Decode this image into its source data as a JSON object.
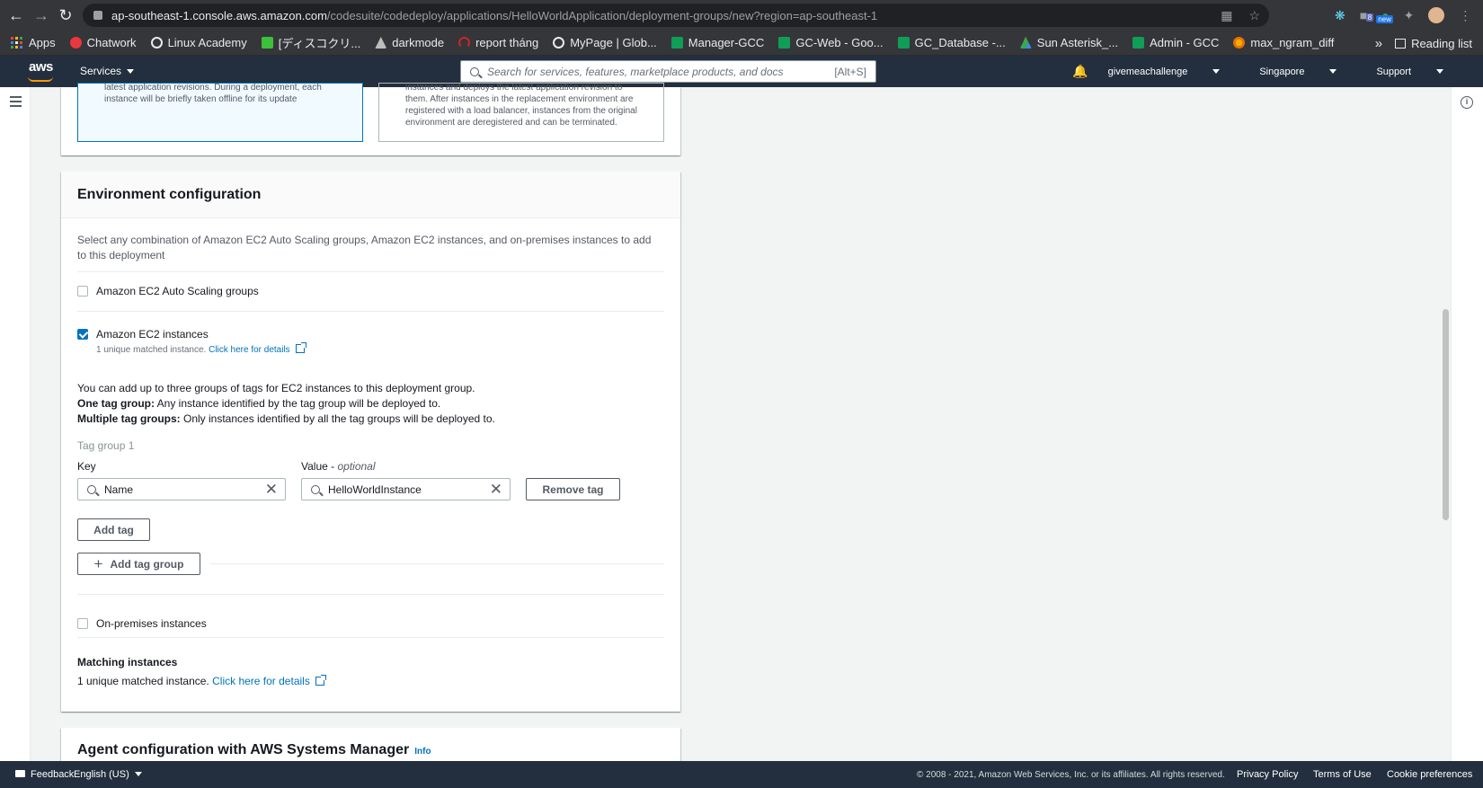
{
  "browser": {
    "url_host": "ap-southeast-1.console.aws.amazon.com",
    "url_path": "/codesuite/codedeploy/applications/HelloWorldApplication/deployment-groups/new?region=ap-southeast-1",
    "ext_badge_1": "8",
    "ext_badge_2": "new",
    "bookmarks": [
      "Apps",
      "Chatwork",
      "Linux Academy",
      "[ディスコクリ...",
      "darkmode",
      "report tháng",
      "MyPage | Glob...",
      "Manager-GCC",
      "GC-Web - Goo...",
      "GC_Database -...",
      "Sun Asterisk_...",
      "Admin - GCC",
      "max_ngram_diff"
    ],
    "more_bookmarks": "»",
    "reading_list": "Reading list"
  },
  "aws_header": {
    "logo": "aws",
    "services": "Services",
    "search_placeholder": "Search for services, features, marketplace products, and docs",
    "search_shortcut": "[Alt+S]",
    "account": "givemeachallenge",
    "region": "Singapore",
    "support": "Support"
  },
  "deployment_tiles": {
    "in_place": [
      "latest application revisions. During a deployment, each",
      "instance will be briefly taken offline for its update"
    ],
    "blue_green": [
      "instances and deploys the latest application revision to",
      "them. After instances in the replacement environment are",
      "registered with a load balancer, instances from the original",
      "environment are deregistered and can be terminated."
    ]
  },
  "env_config": {
    "title": "Environment configuration",
    "description": "Select any combination of Amazon EC2 Auto Scaling groups, Amazon EC2 instances, and on-premises instances to add to this deployment",
    "asg_label": "Amazon EC2 Auto Scaling groups",
    "ec2_label": "Amazon EC2 instances",
    "ec2_matched": "1 unique matched instance.",
    "details_link": "Click here for details",
    "tags_info_line1": "You can add up to three groups of tags for EC2 instances to this deployment group.",
    "one_tag_bold": "One tag group:",
    "one_tag_text": " Any instance identified by the tag group will be deployed to.",
    "multi_tag_bold": "Multiple tag groups:",
    "multi_tag_text": " Only instances identified by all the tag groups will be deployed to.",
    "tag_group_title": "Tag group 1",
    "key_label": "Key",
    "value_label": "Value - ",
    "value_optional": "optional",
    "key_value": "Name",
    "value_value": "HelloWorldInstance",
    "remove_tag": "Remove tag",
    "add_tag": "Add tag",
    "add_tag_group": "Add tag group",
    "onprem_label": "On-premises instances",
    "matching_title": "Matching instances",
    "matching_text": "1 unique matched instance.",
    "matching_link": "Click here for details"
  },
  "agent_config": {
    "title": "Agent configuration with AWS Systems Manager",
    "info": "Info"
  },
  "footer": {
    "feedback": "Feedback",
    "language": "English (US)",
    "copyright": "© 2008 - 2021, Amazon Web Services, Inc. or its affiliates. All rights reserved.",
    "privacy": "Privacy Policy",
    "terms": "Terms of Use",
    "cookies": "Cookie preferences"
  }
}
